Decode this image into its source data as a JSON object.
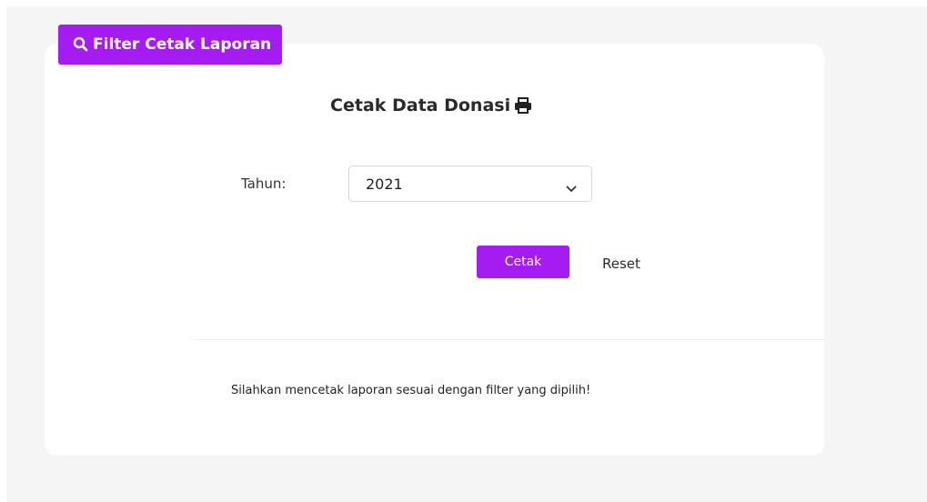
{
  "filter_tag": {
    "icon": "search-icon",
    "label": "Filter Cetak Laporan"
  },
  "form": {
    "title": "Cetak Data Donasi",
    "title_icon": "print-icon",
    "year_label": "Tahun:",
    "year_value": "2021",
    "print_button": "Cetak",
    "reset_button": "Reset"
  },
  "footer_note": "Silahkan mencetak laporan sesuai dengan filter yang dipilih!",
  "colors": {
    "accent": "#a41cf2",
    "background": "#f5f5f5",
    "card": "#ffffff"
  }
}
